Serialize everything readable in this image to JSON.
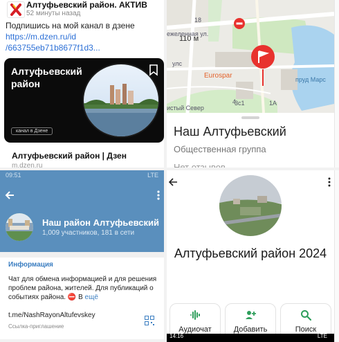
{
  "zen_post": {
    "channel_title": "Алтуфьевский район. АКТИВ",
    "posted_ago": "52 минуты назад",
    "text": "Подпишись на мой канал в дзене",
    "link_line1": "https://m.dzen.ru/id",
    "link_line2": "/663755eb71b8677f1d3...",
    "card_title": "Алтуфьевский район",
    "card_chip": "канал в Дзене",
    "footer_title": "Алтуфьевский район | Дзен",
    "footer_domain": "m.dzen.ru",
    "icons": [
      "channel-logo-icon",
      "bookmark-icon"
    ]
  },
  "map_group": {
    "map_labels": {
      "street": "ежеленная ул.",
      "scale": "110 м",
      "shop": "Eurospar",
      "pond": "пруд Марс",
      "bottom": "истый Север",
      "house_18": "18",
      "house_1a": "1А",
      "house_3c1": "3с1",
      "road": "улс",
      "house_4": "4"
    },
    "group_name": "Наш Алтуфьевский",
    "group_type": "Общественная группа",
    "reviews": "Нет отзывов",
    "colors": {
      "pin": "#e8322e",
      "water": "#aad3ef",
      "park": "#c8e6b8"
    }
  },
  "telegram": {
    "status_left": "09:51",
    "status_right": "LTE",
    "title": "Наш район Алтуфьевский",
    "subtitle": "1,009 участников, 181 в сети",
    "info_heading": "Информация",
    "description": "Чат для обмена информацией и для решения проблем района, жителей. Для публикаций о событиях района. ⛔ В",
    "more": "ещё",
    "link": "t.me/NashRayonAltufevskey",
    "link_caption": "Ссылка-приглашение",
    "header_color": "#5a8fbd"
  },
  "profile": {
    "title": "Алтуфьевский район 2024",
    "buttons": [
      {
        "label": "Аудиочат",
        "icon": "audio-wave-icon"
      },
      {
        "label": "Добавить",
        "icon": "add-user-icon"
      },
      {
        "label": "Поиск",
        "icon": "search-icon"
      }
    ],
    "status_time": "14:16",
    "status_right": "LTE"
  }
}
